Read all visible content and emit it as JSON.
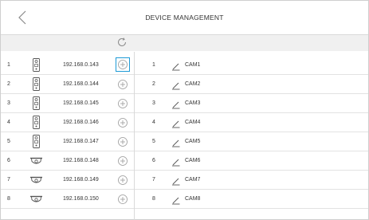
{
  "header": {
    "title": "DEVICE MANAGEMENT",
    "back_icon": "chevron-left-icon"
  },
  "toolbar": {
    "refresh_icon": "refresh-icon"
  },
  "devices": [
    {
      "index": "1",
      "type": "door-station",
      "ip": "192.168.0.143",
      "selected": true
    },
    {
      "index": "2",
      "type": "door-station",
      "ip": "192.168.0.144",
      "selected": false
    },
    {
      "index": "3",
      "type": "door-station",
      "ip": "192.168.0.145",
      "selected": false
    },
    {
      "index": "4",
      "type": "door-station",
      "ip": "192.168.0.146",
      "selected": false
    },
    {
      "index": "5",
      "type": "door-station",
      "ip": "192.168.0.147",
      "selected": false
    },
    {
      "index": "6",
      "type": "dome-camera",
      "ip": "192.168.0.148",
      "selected": false
    },
    {
      "index": "7",
      "type": "dome-camera",
      "ip": "192.168.0.149",
      "selected": false
    },
    {
      "index": "8",
      "type": "dome-camera",
      "ip": "192.168.0.150",
      "selected": false
    }
  ],
  "cameras": [
    {
      "index": "1",
      "name": "CAM1"
    },
    {
      "index": "2",
      "name": "CAM2"
    },
    {
      "index": "3",
      "name": "CAM3"
    },
    {
      "index": "4",
      "name": "CAM4"
    },
    {
      "index": "5",
      "name": "CAM5"
    },
    {
      "index": "6",
      "name": "CAM6"
    },
    {
      "index": "7",
      "name": "CAM7"
    },
    {
      "index": "8",
      "name": "CAM8"
    }
  ],
  "colors": {
    "accent": "#1e9ad6",
    "toolbar_bg": "#f0f0f0",
    "divider": "#d9d9d9",
    "icon_gray": "#8a8a8a"
  }
}
